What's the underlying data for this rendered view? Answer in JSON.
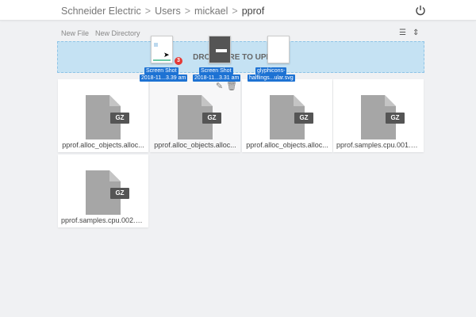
{
  "breadcrumb": [
    "Schneider Electric",
    "Users",
    "mickael",
    "pprof"
  ],
  "breadcrumb_separator": ">",
  "header": {
    "power_icon": "power-icon"
  },
  "toolbar": {
    "new_file": "New File",
    "new_directory": "New Directory",
    "list_view_icon": "list-icon",
    "sort_icon": "sort-icon"
  },
  "dropzone": {
    "label": "DROP HERE TO UPLOAD"
  },
  "dragged": {
    "count": "3",
    "items": [
      {
        "line1": "Screen Shot",
        "line2": "2018-11...3.39 am"
      },
      {
        "line1": "Screen Shot",
        "line2": "2018-11...3.31 am"
      },
      {
        "line1": "glyphicons-",
        "line2": "halflings...ular.svg"
      }
    ]
  },
  "files": [
    {
      "name": "pprof.alloc_objects.alloc...",
      "ext": "GZ"
    },
    {
      "name": "pprof.alloc_objects.alloc...",
      "ext": "GZ"
    },
    {
      "name": "pprof.alloc_objects.alloc...",
      "ext": "GZ"
    },
    {
      "name": "pprof.samples.cpu.001.p...",
      "ext": "GZ"
    },
    {
      "name": "pprof.samples.cpu.002.p...",
      "ext": "GZ"
    }
  ],
  "colors": {
    "dropzone": "#c5e2f3",
    "drag_label": "#1d72d3",
    "badge": "#e53935"
  }
}
